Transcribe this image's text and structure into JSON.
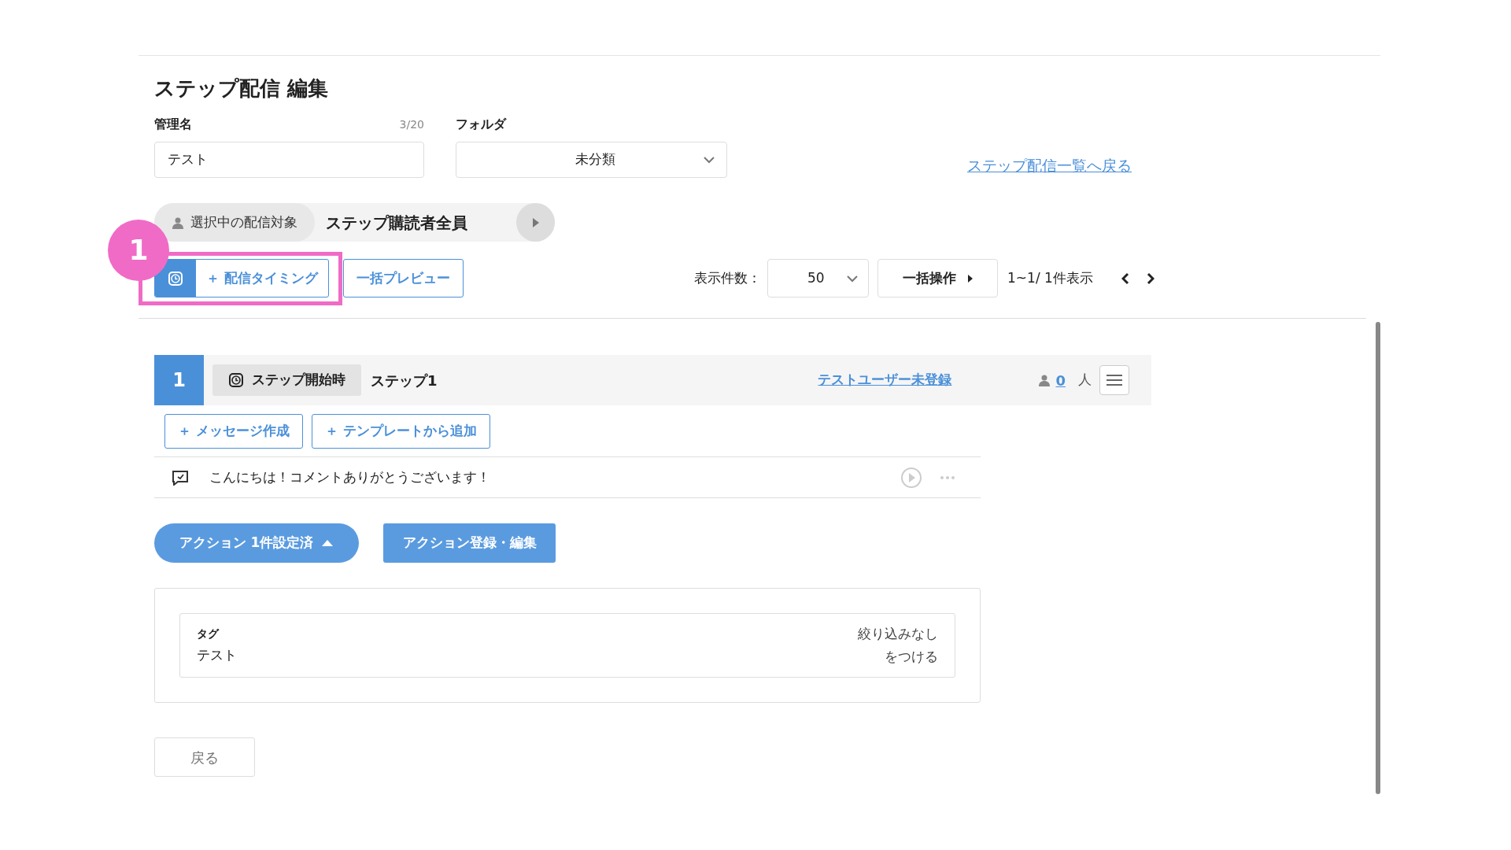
{
  "page_title": "ステップ配信 編集",
  "name_field": {
    "label": "管理名",
    "counter": "3/20",
    "value": "テスト"
  },
  "folder_field": {
    "label": "フォルダ",
    "value": "未分類"
  },
  "back_to_list_link": "ステップ配信一覧へ戻る",
  "target": {
    "label": "選択中の配信対象",
    "value": "ステップ購読者全員"
  },
  "annotation": {
    "number": "1"
  },
  "toolbar": {
    "timing_button": "＋ 配信タイミング",
    "preview_button": "一括プレビュー",
    "per_page_label": "表示件数：",
    "per_page_value": "50",
    "bulk_button": "一括操作",
    "range": "1~1/ 1件表示"
  },
  "steps": [
    {
      "number": "1",
      "timing": "ステップ開始時",
      "name": "ステップ1",
      "test_user_link": "テストユーザー未登録",
      "subscriber_count": "0",
      "count_unit": "人",
      "add_buttons": [
        "＋ メッセージ作成",
        "＋ テンプレートから追加"
      ],
      "messages": [
        {
          "text": "こんにちは！コメントありがとうございます！"
        }
      ],
      "actions_toggle": {
        "label": "アクション 1件設定済",
        "expanded": true
      },
      "actions_edit_button": "アクション登録・編集",
      "actions": [
        {
          "type_label": "タグ",
          "value": "テスト",
          "filter": "絞り込みなし",
          "operation": "をつける"
        }
      ]
    }
  ],
  "back_button": "戻る"
}
